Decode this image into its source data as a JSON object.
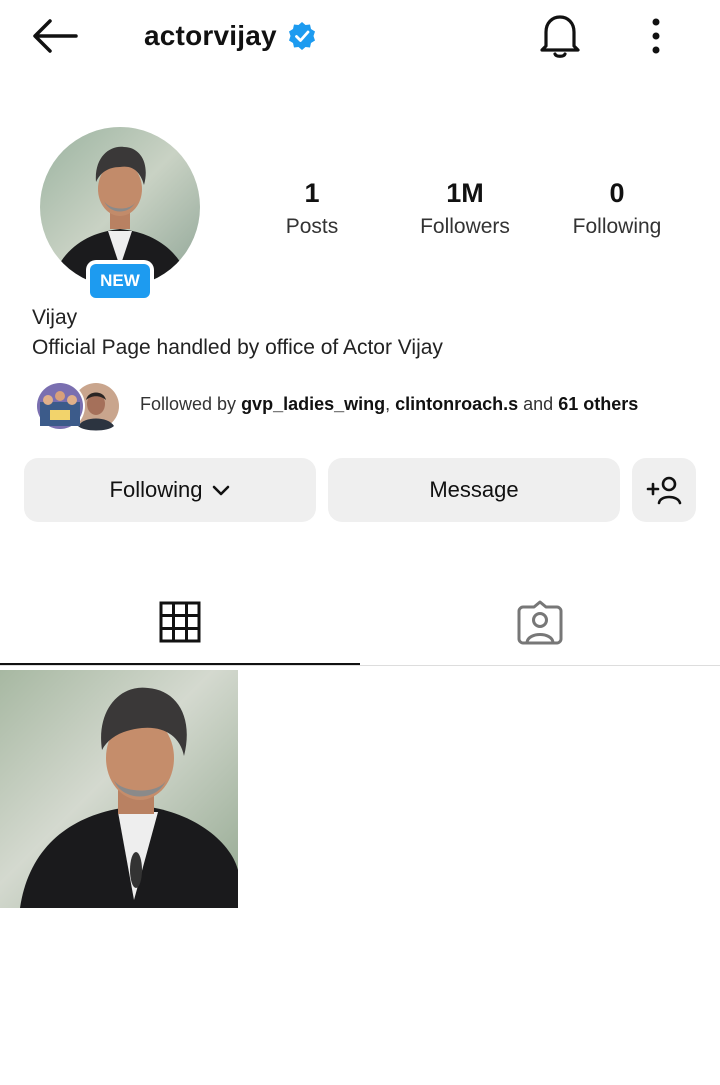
{
  "header": {
    "username": "actorvijay",
    "icons": {
      "back": "arrow-left-icon",
      "verified": "verified-badge-icon",
      "bell": "bell-icon",
      "more": "more-vertical-icon"
    }
  },
  "profile": {
    "badge": "NEW",
    "stats": [
      {
        "value": "1",
        "label": "Posts"
      },
      {
        "value": "1M",
        "label": "Followers"
      },
      {
        "value": "0",
        "label": "Following"
      }
    ],
    "name": "Vijay",
    "bio": "Official Page handled by office of Actor Vijay"
  },
  "mutual": {
    "prefix": "Followed by ",
    "user1": "gvp_ladies_wing",
    "sep": ", ",
    "user2": "clintonroach.s",
    "and": " and ",
    "others": "61 others"
  },
  "actions": {
    "following_label": "Following",
    "message_label": "Message"
  },
  "tabs": {
    "grid_icon": "grid-icon",
    "tagged_icon": "tagged-person-icon",
    "active": "grid"
  },
  "colors": {
    "accent": "#1d9bf0",
    "button_bg": "#efefef"
  }
}
